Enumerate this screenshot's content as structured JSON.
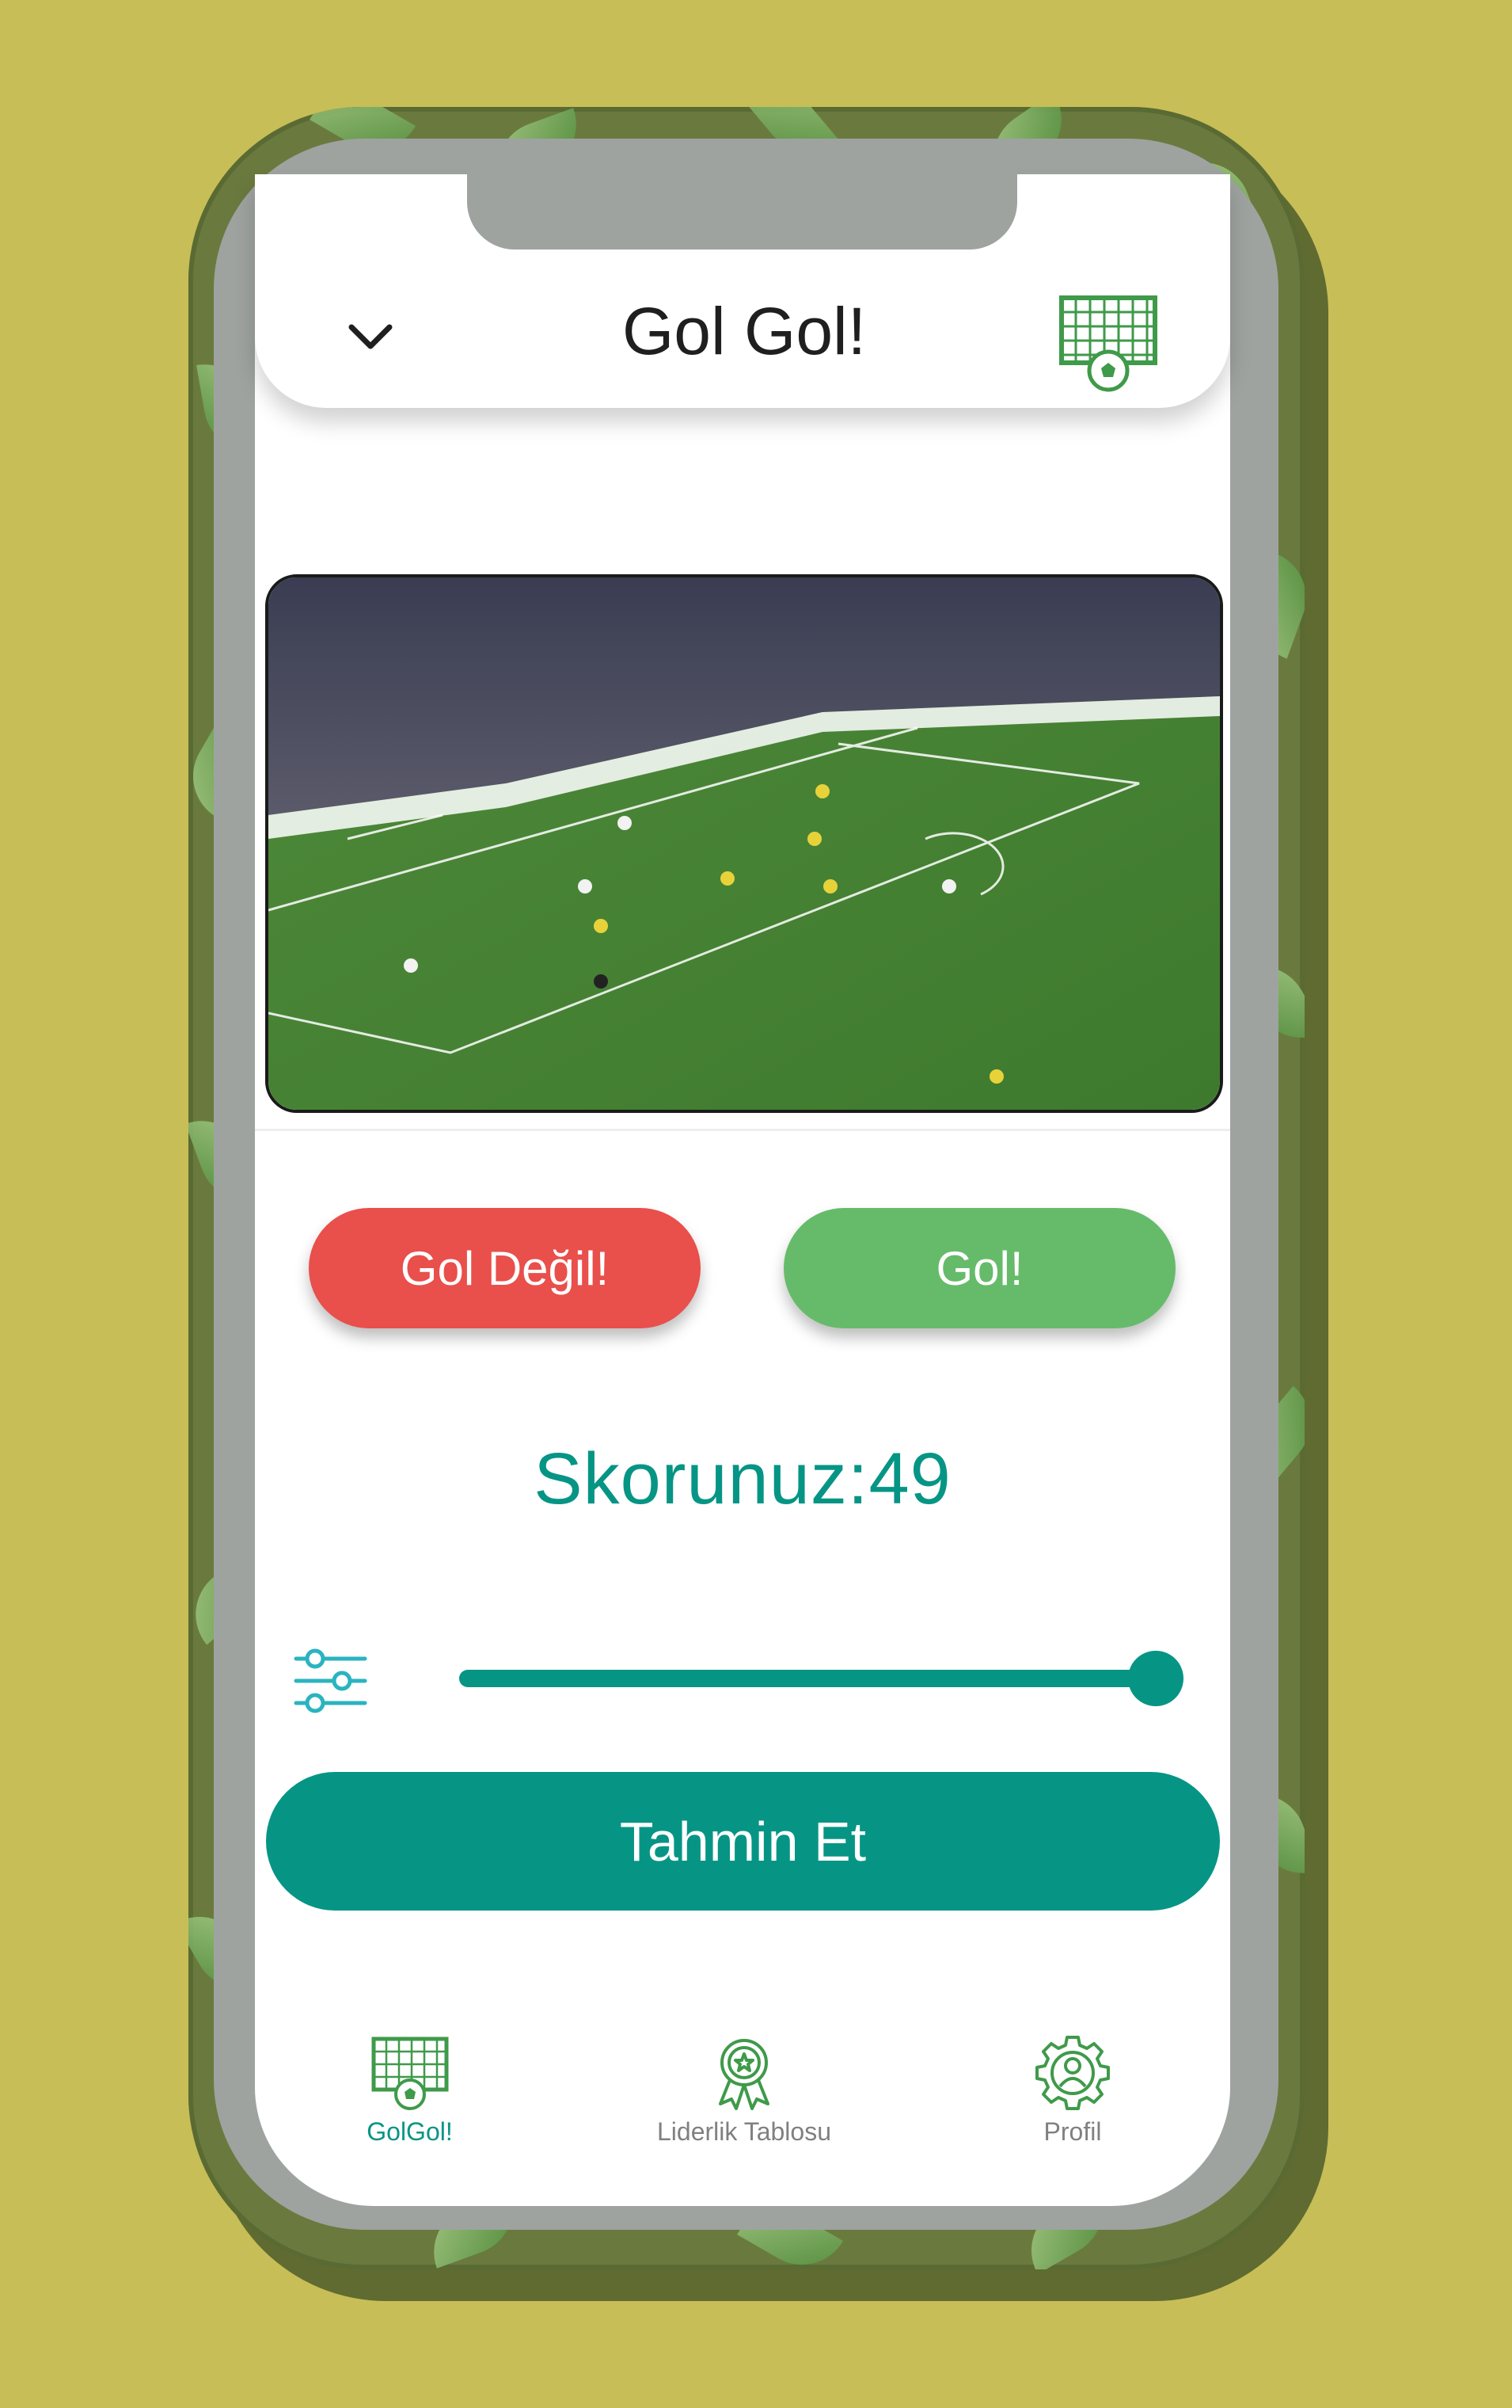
{
  "colors": {
    "background": "#c7be57",
    "accent": "#069585",
    "no_goal": "#e94f4b",
    "goal": "#66bb6a"
  },
  "header": {
    "title": "Gol Gol!",
    "back_icon": "chevron-down-icon",
    "goal_icon": "soccer-goal-icon"
  },
  "video": {
    "description_icon": "football-match-video"
  },
  "actions": {
    "no_goal_label": "Gol Değil!",
    "goal_label": "Gol!"
  },
  "score": {
    "text": "Skorunuz:49"
  },
  "slider": {
    "icon": "sliders-icon",
    "value_fraction": 1.0
  },
  "guess": {
    "label": "Tahmin Et"
  },
  "nav": {
    "items": [
      {
        "label": "GolGol!",
        "icon": "soccer-goal-icon",
        "active": true
      },
      {
        "label": "Liderlik Tablosu",
        "icon": "award-ribbon-icon",
        "active": false
      },
      {
        "label": "Profil",
        "icon": "profile-gear-icon",
        "active": false
      }
    ]
  }
}
